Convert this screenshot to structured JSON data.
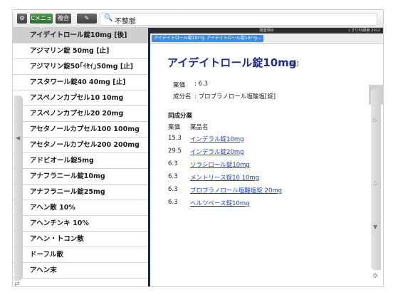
{
  "toolbar": {
    "gear_icon": "⚙",
    "menu_label": "Cメニュー",
    "combine_label": "複合",
    "pen_icon": "✎",
    "search_icon": "🔍",
    "search_value": "不整脈"
  },
  "list": {
    "items": [
      "アイデイトロール錠10mg [後]",
      "アジマリン錠 50mg [止]",
      "アジマリン錠50｢ｲｾｲ｣50mg [止]",
      "アスタワール錠40 40mg [止]",
      "アスペノンカプセル10 10mg",
      "アスペノンカプセル20 20mg",
      "アセタノールカプセル100 100mg",
      "アセタノールカプセル200 200mg",
      "アドビオール錠5mg",
      "アナフラニール錠10mg",
      "アナフラニール錠25mg",
      "アヘン散 10%",
      "アヘンチンキ 10%",
      "アヘン・トコン散",
      "ドーフル散",
      "アヘン末"
    ],
    "left_arrow": "◀",
    "bottom_icon": "⇄"
  },
  "header": {
    "center_text": "関連項目",
    "right_text": "くすりSS検索 2012"
  },
  "breadcrumbs": [
    "アイデイトロール錠10mg...",
    "アイデイトロール錠10mg..."
  ],
  "detail": {
    "title": "アイデイトロール錠10mg",
    "tag": "[後]",
    "price_label": "薬価",
    "price_value": ": 6.3",
    "ingredient_label": "成分名",
    "ingredient_value": ": プロプラノロール塩酸塩[錠]",
    "section_title": "同成分薬",
    "col_price": "薬価",
    "col_name": "薬品名",
    "rows": [
      {
        "price": "15.3",
        "name": "インデラル錠10mg"
      },
      {
        "price": "29.5",
        "name": "インデラル錠20mg"
      },
      {
        "price": "6.3",
        "name": "ソラシロール錠10mg"
      },
      {
        "price": "6.3",
        "name": "メントリース錠10 10mg"
      },
      {
        "price": "6.3",
        "name": "プロプラノロール塩酸塩錠 20mg"
      },
      {
        "price": "6.3",
        "name": "ヘルツベース錠10mg"
      }
    ]
  },
  "right_rail": {
    "plus": "+",
    "up_icon": "▷",
    "mid_icon": "△",
    "down_icon": "▼",
    "gear_icon": "✲"
  }
}
